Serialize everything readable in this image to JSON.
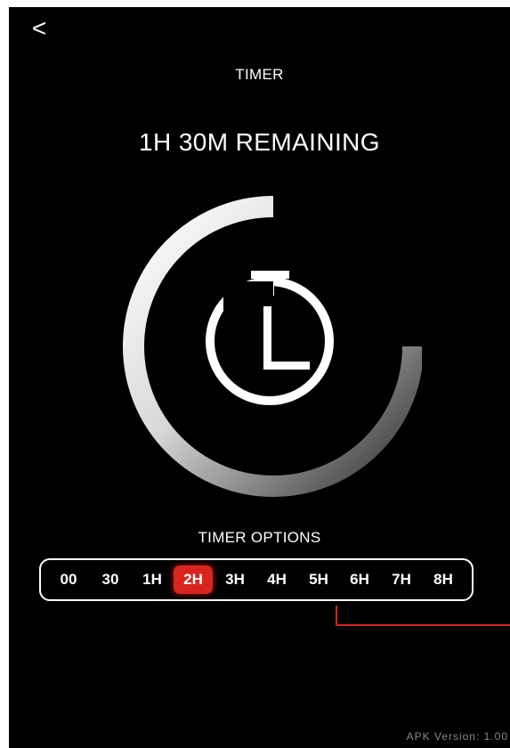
{
  "app": {
    "back_label": "<",
    "title": "TIMER",
    "remaining": "1H 30M REMAINING"
  },
  "timer": {
    "progress_fraction": 0.75,
    "icon": "stopwatch-icon"
  },
  "options": {
    "label": "TIMER OPTIONS",
    "items": [
      "00",
      "30",
      "1H",
      "2H",
      "3H",
      "4H",
      "5H",
      "6H",
      "7H",
      "8H"
    ],
    "selected": "2H"
  },
  "footer": {
    "version": "APK Version: 1.00"
  },
  "colors": {
    "background": "#000000",
    "foreground": "#ffffff",
    "accent": "#d9251d",
    "connector": "#d9251d",
    "ring_start": "#ffffff",
    "ring_end": "#2e2e2e"
  }
}
